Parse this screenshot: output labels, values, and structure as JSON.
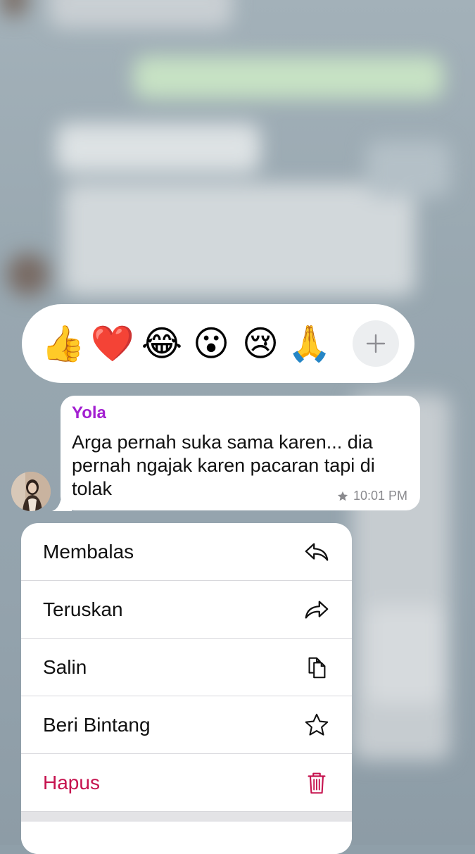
{
  "reactions": {
    "items": [
      {
        "name": "thumbs-up",
        "glyph": "👍"
      },
      {
        "name": "red-heart",
        "glyph": "❤️"
      },
      {
        "name": "tears-of-joy",
        "glyph": "😂"
      },
      {
        "name": "surprised",
        "glyph": "😮"
      },
      {
        "name": "crying",
        "glyph": "😢"
      },
      {
        "name": "folded-hands",
        "glyph": "🙏"
      }
    ],
    "more_icon": "plus-icon"
  },
  "message": {
    "sender": "Yola",
    "text": "Arga pernah suka sama karen... dia pernah ngajak karen pacaran tapi di tolak",
    "time": "10:01 PM",
    "starred": true,
    "sender_color": "#a31fd1"
  },
  "menu": {
    "items": [
      {
        "label": "Membalas",
        "icon": "reply-icon"
      },
      {
        "label": "Teruskan",
        "icon": "forward-icon"
      },
      {
        "label": "Salin",
        "icon": "copy-icon"
      },
      {
        "label": "Beri Bintang",
        "icon": "star-icon"
      },
      {
        "label": "Hapus",
        "icon": "trash-icon",
        "color": "#c6134f"
      }
    ]
  }
}
